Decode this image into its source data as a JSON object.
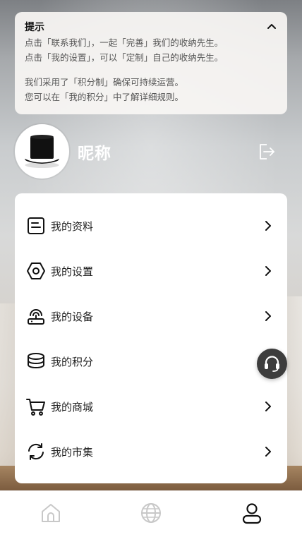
{
  "notice": {
    "title": "提示",
    "lines": [
      "点击「联系我们」，一起「完善」我们的收纳先生。",
      "点击「我的设置」，可以「定制」自己的收纳先生。",
      "我们采用了「积分制」确保可持续运营。",
      "您可以在「我的积分」中了解详细规则。"
    ],
    "toggle_icon": "chevron-up-icon"
  },
  "profile": {
    "nickname": "昵称",
    "avatar_icon": "top-hat-icon",
    "logout_icon": "logout-icon"
  },
  "menu": {
    "items": [
      {
        "label": "我的资料",
        "icon": "profile-card-icon"
      },
      {
        "label": "我的设置",
        "icon": "hex-settings-icon"
      },
      {
        "label": "我的设备",
        "icon": "device-icon"
      },
      {
        "label": "我的积分",
        "icon": "coin-stack-icon"
      },
      {
        "label": "我的商城",
        "icon": "cart-icon"
      },
      {
        "label": "我的市集",
        "icon": "exchange-icon"
      }
    ]
  },
  "support_icon": "headset-icon",
  "tabbar": {
    "tabs": [
      {
        "name": "home",
        "icon": "home-icon",
        "active": false
      },
      {
        "name": "explore",
        "icon": "globe-icon",
        "active": false
      },
      {
        "name": "me",
        "icon": "user-icon",
        "active": true
      }
    ]
  },
  "colors": {
    "active_tab": "#111111",
    "inactive_tab": "#c8c8c8",
    "support_bg": "#3d3d3d"
  }
}
